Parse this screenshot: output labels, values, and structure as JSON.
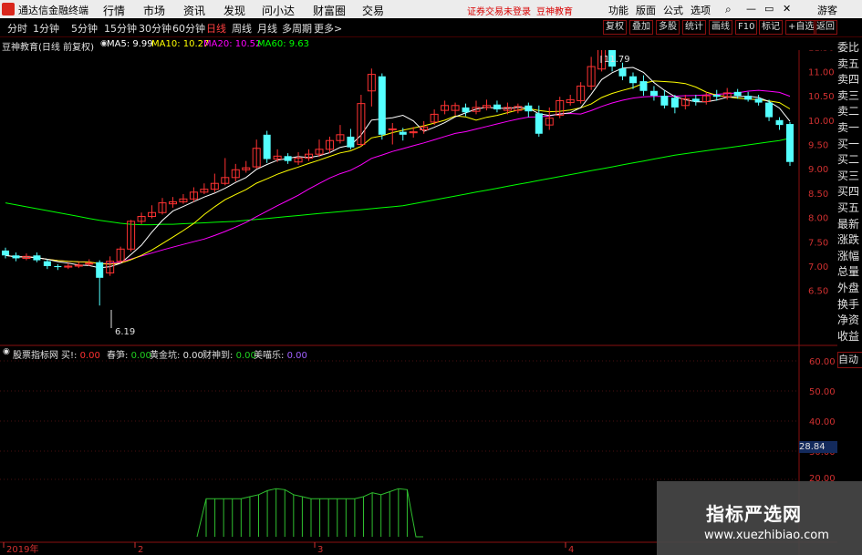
{
  "menubar": {
    "app_title": "通达信金融终端",
    "menus": [
      "行情",
      "市场",
      "资讯",
      "发现",
      "问小达",
      "财富圈",
      "交易"
    ],
    "notice": "证券交易未登录",
    "brand": "豆神教育",
    "right": [
      "功能",
      "版面",
      "公式",
      "选项"
    ],
    "user": "游客"
  },
  "toolbar": {
    "periods": [
      "分时",
      "1分钟",
      "5分钟",
      "15分钟",
      "30分钟",
      "60分钟",
      "日线",
      "周线",
      "月线",
      "多周期",
      "更多>"
    ],
    "active": "日线",
    "right_buttons": [
      "复权",
      "叠加",
      "多股",
      "统计",
      "画线",
      "F10",
      "标记",
      "+自选",
      "返回"
    ]
  },
  "infobar": {
    "stock": "豆神教育(日线 前复权)",
    "ma5": "MA5: 9.99",
    "ma10": "MA10: 10.27",
    "ma20": "MA20: 10.52",
    "ma60": "MA60: 9.63"
  },
  "price_axis": [
    "11.50",
    "11.00",
    "10.50",
    "10.00",
    "9.50",
    "9.00",
    "8.50",
    "8.00",
    "7.50",
    "7.00",
    "6.50"
  ],
  "annotations": {
    "high": "11.79",
    "low": "6.19"
  },
  "side_tabs": [
    "委比",
    "卖五",
    "卖四",
    "卖三",
    "卖二",
    "卖一",
    "买一",
    "买二",
    "买三",
    "买四",
    "买五",
    "最新",
    "涨跌",
    "涨幅",
    "总量",
    "外盘",
    "换手",
    "净资",
    "收益"
  ],
  "indicator": {
    "name": "股票指标网",
    "fields": [
      {
        "label": "买!: ",
        "value": "0.00",
        "color": "#ff3030"
      },
      {
        "label": "春笋: ",
        "value": "0.00",
        "color": "#20d020"
      },
      {
        "label": "黄金坑: ",
        "value": "0.00",
        "color": "#ffd000"
      },
      {
        "label": "财神到: ",
        "value": "0.00",
        "color": "#20d020"
      },
      {
        "label": "美喵乐: ",
        "value": "0.00",
        "color": "#a060ff"
      }
    ]
  },
  "indicator_axis": [
    "60.00",
    "50.00",
    "40.00",
    "30.00",
    "20.00"
  ],
  "indicator_current": "28.84",
  "auto_button": "自动",
  "date_axis": [
    "2019年",
    "2",
    "3",
    "4"
  ],
  "watermark": {
    "title": "指标严选网",
    "url": "www.xuezhibiao.com"
  },
  "colors": {
    "up": "#ff3232",
    "down": "#54ffff",
    "ma5": "#ffffff",
    "ma10": "#ffff00",
    "ma20": "#ff00ff",
    "ma60": "#00ff00"
  }
}
